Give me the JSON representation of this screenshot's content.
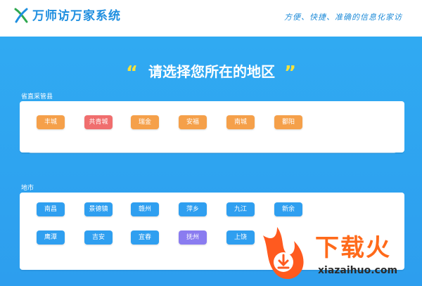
{
  "header": {
    "logo_text": "万师访万家系统",
    "slogan": "方便、快捷、准确的信息化家访"
  },
  "main": {
    "title": "请选择您所在的地区",
    "quote_left": "“",
    "quote_right": "”"
  },
  "sections": [
    {
      "label": "省直采管县",
      "items": [
        {
          "label": "丰城",
          "color": "#f5a04a"
        },
        {
          "label": "共青城",
          "color": "#f06e6e"
        },
        {
          "label": "瑞金",
          "color": "#f5a04a"
        },
        {
          "label": "安福",
          "color": "#f5a04a"
        },
        {
          "label": "南城",
          "color": "#f5a04a"
        },
        {
          "label": "鄱阳",
          "color": "#f5a04a"
        }
      ]
    },
    {
      "label": "地市",
      "items": [
        {
          "label": "南昌",
          "color": "#2f9ff0"
        },
        {
          "label": "景德镇",
          "color": "#2f9ff0"
        },
        {
          "label": "赣州",
          "color": "#2f9ff0"
        },
        {
          "label": "萍乡",
          "color": "#2f9ff0"
        },
        {
          "label": "九江",
          "color": "#2f9ff0"
        },
        {
          "label": "新余",
          "color": "#2f9ff0"
        },
        {
          "label": "鹰潭",
          "color": "#2f9ff0"
        },
        {
          "label": "吉安",
          "color": "#2f9ff0"
        },
        {
          "label": "宜春",
          "color": "#2f9ff0"
        },
        {
          "label": "抚州",
          "color": "#8a7cf0"
        },
        {
          "label": "上饶",
          "color": "#2f9ff0"
        }
      ]
    }
  ],
  "watermark": {
    "text": "下载火",
    "site": "xiazaihuo.com"
  }
}
